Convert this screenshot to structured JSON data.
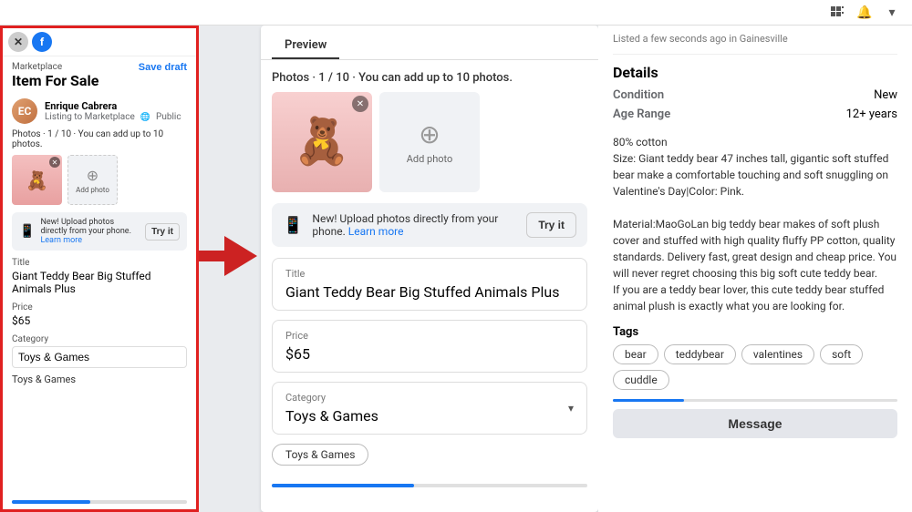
{
  "topbar": {
    "icons": [
      "grid-icon",
      "bell-icon",
      "chevron-icon"
    ]
  },
  "left_panel": {
    "marketplace_label": "Marketplace",
    "title": "Item For Sale",
    "save_draft": "Save draft",
    "user": {
      "name": "Enrique Cabrera",
      "initials": "EC",
      "listing_to": "Listing to Marketplace",
      "visibility": "Public"
    },
    "photos_label": "Photos · 1 / 10 · You can add up to 10 photos.",
    "add_photo_label": "Add photo",
    "upload_banner": {
      "text": "New! Upload photos directly from your phone.",
      "learn_more": "Learn more",
      "try_it": "Try it"
    },
    "title_label": "Title",
    "title_value": "Giant Teddy Bear Big Stuffed Animals Plus",
    "price_label": "Price",
    "price_value": "$65",
    "category_label": "Category",
    "category_value": "Toys & Games",
    "subcategory": "Toys & Games"
  },
  "preview": {
    "tab": "Preview",
    "photos_label": "Photos · 1 / 10 · You can add up to 10 photos.",
    "add_photo": "Add photo",
    "upload_banner": {
      "text": "New! Upload photos directly from your phone.",
      "learn_more": "Learn more",
      "try_it": "Try it"
    },
    "title_label": "Title",
    "title_value": "Giant Teddy Bear Big Stuffed Animals Plus",
    "price_label": "Price",
    "price_value": "$65",
    "category_label": "Category",
    "category_value": "Toys & Games",
    "subcategory_tag": "Toys & Games"
  },
  "right_panel": {
    "listed_ago": "Listed a few seconds ago in Gainesville",
    "details_title": "Details",
    "condition_label": "Condition",
    "condition_value": "New",
    "age_range_label": "Age Range",
    "age_range_value": "12+ years",
    "description": "80% cotton\nSize: Giant teddy bear 47 inches tall, gigantic soft stuffed bear make a comfortable touching and soft snuggling on Valentine's Day|Color: Pink.\n\nMaterial:MaoGoLan big teddy bear makes of soft plush cover and stuffed with high quality fluffy PP cotton, quality standards. Delivery fast, great design and cheap price. You will never regret choosing this big soft cute teddy bear.\nIf you are a teddy bear lover, this cute teddy bear stuffed animal plush is exactly what you are looking for.",
    "tags_label": "Tags",
    "tags": [
      "bear",
      "teddybear",
      "valentines",
      "soft",
      "cuddle"
    ],
    "message_btn": "Message"
  }
}
